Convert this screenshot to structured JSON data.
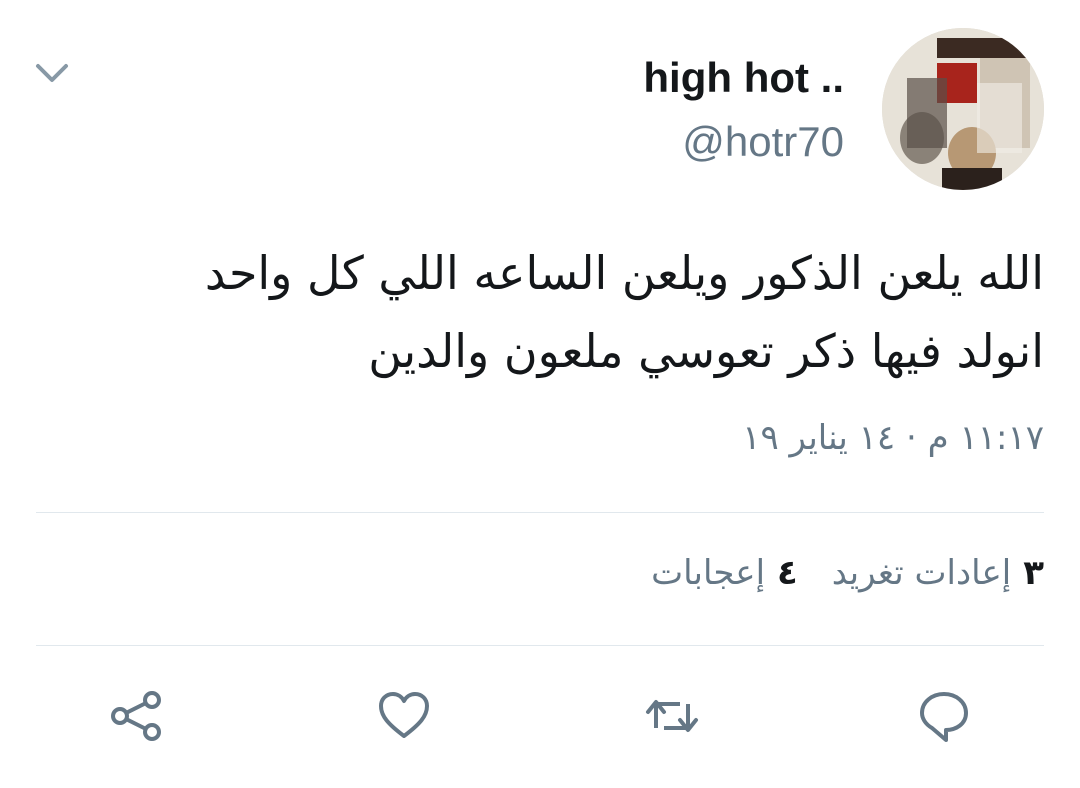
{
  "header": {
    "display_name": "high hot ..",
    "handle": "@hotr70",
    "menu_icon": "chevron-down-icon",
    "avatar_icon": "avatar-image"
  },
  "tweet": {
    "text_line1": "الله يلعن الذكور ويلعن الساعه اللي كل واحد",
    "text_line2": "انولد فيها ذكر تعوسي ملعون والدين",
    "timestamp": "١١:١٧ م · ١٤ يناير ١٩"
  },
  "stats": {
    "retweets_count": "٣",
    "retweets_label": "إعادات تغريد",
    "likes_count": "٤",
    "likes_label": "إعجابات"
  },
  "actions": {
    "reply_icon": "reply-icon",
    "retweet_icon": "retweet-icon",
    "like_icon": "heart-icon",
    "share_icon": "share-icon"
  },
  "colors": {
    "text_primary": "#14171a",
    "text_secondary": "#657786",
    "divider": "#e1e8ed",
    "icon": "#657786"
  }
}
